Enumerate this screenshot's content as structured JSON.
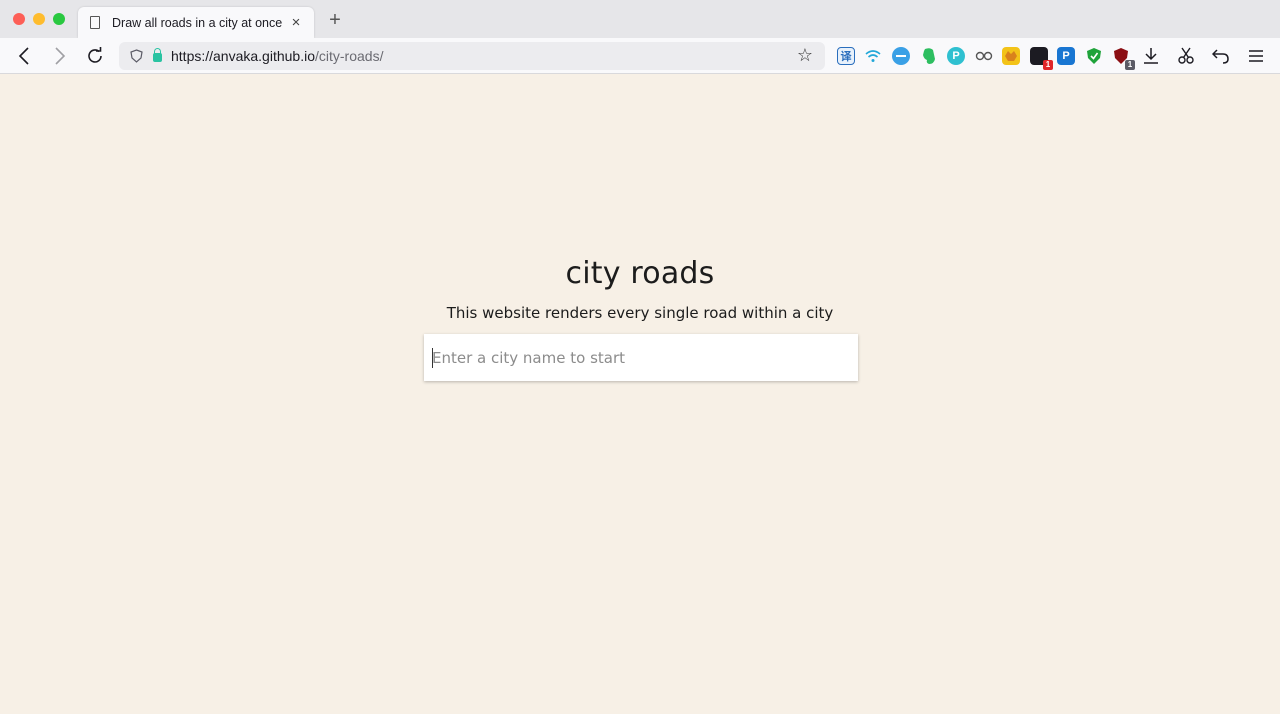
{
  "browser": {
    "tab": {
      "title": "Draw all roads in a city at once",
      "close_glyph": "×"
    },
    "new_tab_glyph": "+",
    "url": {
      "host": "https://anvaka.github.io",
      "path": "/city-roads/"
    },
    "extension_badges": {
      "dark_ext": "1",
      "shield_red_ext": "1"
    }
  },
  "page": {
    "title": "city roads",
    "subtitle": "This website renders every single road within a city",
    "search": {
      "placeholder": "Enter a city name to start",
      "value": ""
    }
  },
  "colors": {
    "page_background": "#f7f0e6",
    "tabstrip": "#e6e6e9",
    "toolbar": "#f9f9fb"
  },
  "icons": [
    "document-icon",
    "back-arrow-icon",
    "forward-arrow-icon",
    "reload-icon",
    "shield-icon",
    "lock-icon",
    "star-icon",
    "download-icon",
    "scissors-icon",
    "undo-icon",
    "hamburger-menu-icon"
  ]
}
